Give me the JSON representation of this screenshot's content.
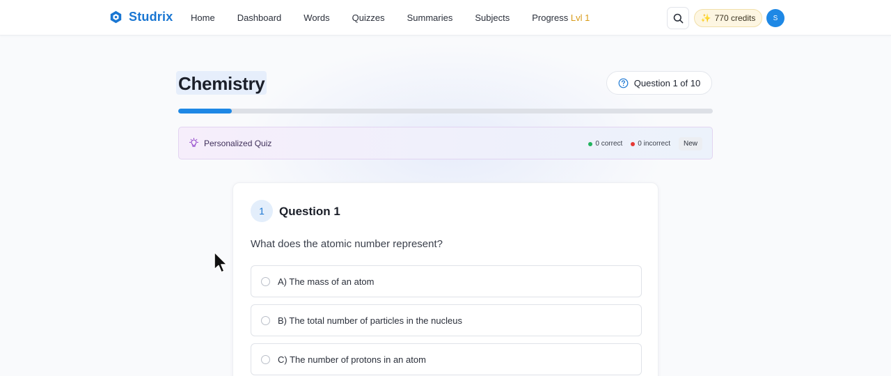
{
  "brand": {
    "name": "Studrix",
    "color": "#1976d2"
  },
  "nav": {
    "items": [
      {
        "label": "Home"
      },
      {
        "label": "Dashboard"
      },
      {
        "label": "Words"
      },
      {
        "label": "Quizzes"
      },
      {
        "label": "Summaries"
      },
      {
        "label": "Subjects"
      }
    ],
    "progress": {
      "label": "Progress",
      "level": "Lvl 1"
    },
    "search_icon": "search-icon",
    "credits": {
      "icon": "sparkle-icon",
      "label": "770 credits"
    },
    "avatar_initial": "S"
  },
  "header": {
    "title": "Chemistry",
    "question_count": "Question 1 of 10",
    "question_icon": "help-circle-icon"
  },
  "progress_bar": {
    "fraction": 0.1,
    "fill_color": "#1e88e5"
  },
  "banner": {
    "icon": "lightbulb-icon",
    "title": "Personalized Quiz",
    "correct": "0 correct",
    "incorrect": "0 incorrect",
    "badge": "New"
  },
  "question": {
    "number": "1",
    "title": "Question 1",
    "text": "What does the atomic number represent?",
    "options": [
      {
        "label": "A) The mass of an atom"
      },
      {
        "label": "B) The total number of particles in the nucleus"
      },
      {
        "label": "C) The number of protons in an atom"
      }
    ]
  },
  "colors": {
    "accent": "#1976d2",
    "credits_bg": "#fdf6e2",
    "level": "#d89b18",
    "correct": "#22b35e",
    "incorrect": "#e53935"
  }
}
